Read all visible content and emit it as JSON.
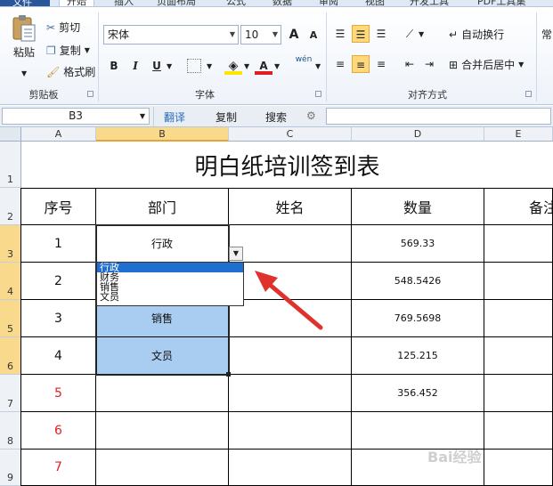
{
  "ribbon": {
    "tabs": [
      "文件",
      "开始",
      "插入",
      "页面布局",
      "公式",
      "数据",
      "审阅",
      "视图",
      "开发工具",
      "PDF工具集"
    ],
    "clipboard": {
      "paste": "粘贴",
      "cut": "剪切",
      "copy": "复制",
      "format_painter": "格式刷",
      "label": "剪贴板"
    },
    "font": {
      "name": "宋体",
      "size": "10",
      "label": "字体",
      "bold": "B",
      "italic": "I",
      "underline": "U",
      "grow": "A",
      "shrink": "A",
      "phonetic": "wén",
      "color_letter": "A"
    },
    "alignment": {
      "wrap_text": "自动换行",
      "merge_center": "合并后居中",
      "label": "对齐方式"
    },
    "number_cut": "常"
  },
  "formula_bar": {
    "name_box": "B3",
    "translate": "翻译",
    "copy": "复制",
    "search": "搜索"
  },
  "grid": {
    "columns": [
      "A",
      "B",
      "C",
      "D",
      "E"
    ],
    "rows": [
      "1",
      "2",
      "3",
      "4",
      "5",
      "6",
      "7",
      "8",
      "9"
    ],
    "title": "明白纸培训签到表",
    "headers": {
      "seq": "序号",
      "dept": "部门",
      "name": "姓名",
      "qty": "数量",
      "note": "备注"
    },
    "data": [
      {
        "seq": "1",
        "dept": "行政",
        "qty": "569.33"
      },
      {
        "seq": "2",
        "dept": "",
        "qty": "548.5426"
      },
      {
        "seq": "3",
        "dept": "销售",
        "qty": "769.5698"
      },
      {
        "seq": "4",
        "dept": "文员",
        "qty": "125.215"
      },
      {
        "seq": "5",
        "dept": "",
        "qty": "356.452"
      },
      {
        "seq": "6",
        "dept": "",
        "qty": ""
      },
      {
        "seq": "7",
        "dept": "",
        "qty": ""
      }
    ]
  },
  "dropdown": {
    "options": [
      "行政",
      "财务",
      "销售",
      "文员"
    ],
    "selected": "行政"
  },
  "colors": {
    "accent": "#2b579a",
    "selection_fill": "#a9cdf0",
    "red_text": "#e02020",
    "arrow": "#e0322d"
  }
}
